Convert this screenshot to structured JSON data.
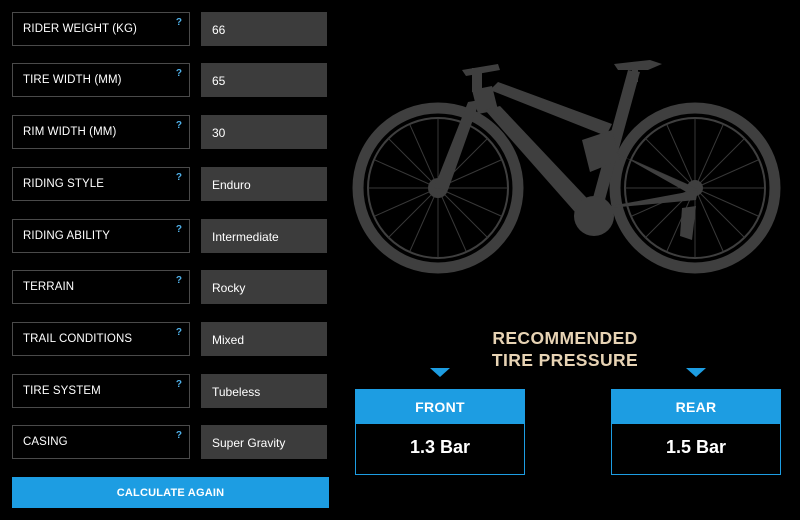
{
  "form": {
    "fields": [
      {
        "label": "RIDER WEIGHT (KG)",
        "help": "?",
        "value": "66"
      },
      {
        "label": "TIRE WIDTH (MM)",
        "help": "?",
        "value": "65"
      },
      {
        "label": "RIM WIDTH (MM)",
        "help": "?",
        "value": "30"
      },
      {
        "label": "RIDING STYLE",
        "help": "?",
        "value": "Enduro"
      },
      {
        "label": "RIDING ABILITY",
        "help": "?",
        "value": "Intermediate"
      },
      {
        "label": "TERRAIN",
        "help": "?",
        "value": "Rocky"
      },
      {
        "label": "TRAIL CONDITIONS",
        "help": "?",
        "value": "Mixed"
      },
      {
        "label": "TIRE SYSTEM",
        "help": "?",
        "value": "Tubeless"
      },
      {
        "label": "CASING",
        "help": "?",
        "value": "Super Gravity"
      }
    ],
    "calculate_label": "CALCULATE AGAIN"
  },
  "result": {
    "title_line1": "RECOMMENDED",
    "title_line2": "TIRE PRESSURE",
    "front": {
      "label": "FRONT",
      "value": "1.3 Bar"
    },
    "rear": {
      "label": "REAR",
      "value": "1.5 Bar"
    }
  },
  "colors": {
    "accent": "#1d9de2",
    "title": "#e7d3b4",
    "field_bg": "#3c3c3c",
    "bike": "#3f3f3f"
  },
  "icons": {
    "help": "question-mark-icon",
    "arrow": "triangle-down-icon",
    "bike": "mountain-bike-illustration"
  }
}
